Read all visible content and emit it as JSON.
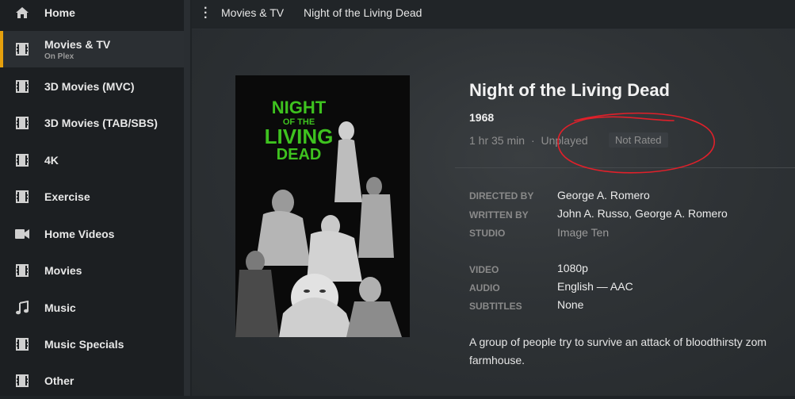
{
  "sidebar": {
    "items": [
      {
        "label": "Home",
        "sub": "",
        "icon": "home-icon"
      },
      {
        "label": "Movies & TV",
        "sub": "On Plex",
        "icon": "film-icon"
      },
      {
        "label": "3D Movies (MVC)",
        "sub": "",
        "icon": "film-icon"
      },
      {
        "label": "3D Movies (TAB/SBS)",
        "sub": "",
        "icon": "film-icon"
      },
      {
        "label": "4K",
        "sub": "",
        "icon": "film-icon"
      },
      {
        "label": "Exercise",
        "sub": "",
        "icon": "film-icon"
      },
      {
        "label": "Home Videos",
        "sub": "",
        "icon": "video-camera-icon"
      },
      {
        "label": "Movies",
        "sub": "",
        "icon": "film-icon"
      },
      {
        "label": "Music",
        "sub": "",
        "icon": "music-note-icon"
      },
      {
        "label": "Music Specials",
        "sub": "",
        "icon": "film-icon"
      },
      {
        "label": "Other",
        "sub": "",
        "icon": "film-icon"
      }
    ],
    "active_index": 1
  },
  "header": {
    "crumb_library": "Movies & TV",
    "crumb_title": "Night of the Living Dead"
  },
  "movie": {
    "title": "Night of the Living Dead",
    "year": "1968",
    "duration": "1 hr 35 min",
    "separator": "·",
    "status": "Unplayed",
    "rating": "Not Rated",
    "poster": {
      "line1": "NIGHT",
      "line2": "OF THE",
      "line3": "LIVING",
      "line4": "DEAD",
      "title_color": "#3ec21f"
    },
    "credits": [
      {
        "label": "DIRECTED BY",
        "value": "George A. Romero"
      },
      {
        "label": "WRITTEN BY",
        "value": "John A. Russo, George A. Romero"
      },
      {
        "label": "STUDIO",
        "value": "Image Ten"
      }
    ],
    "media": [
      {
        "label": "VIDEO",
        "value": "1080p"
      },
      {
        "label": "AUDIO",
        "value": "English — AAC"
      },
      {
        "label": "SUBTITLES",
        "value": "None"
      }
    ],
    "summary_line1": "A group of people try to survive an attack of bloodthirsty zom",
    "summary_line2": "farmhouse."
  },
  "colors": {
    "accent": "#e5a00d",
    "annotation": "#e0202a"
  }
}
